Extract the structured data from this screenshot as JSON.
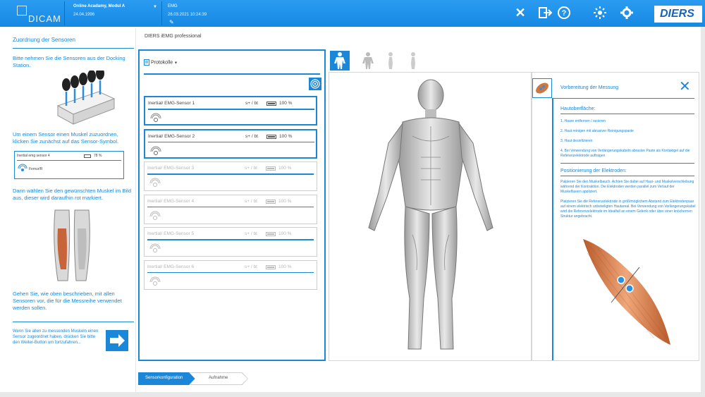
{
  "topbar": {
    "logo_text": "DICAM",
    "patient_name": "Online Acadamy, Modul A",
    "patient_dob": "24.04.1996",
    "exam_type": "EMG",
    "exam_datetime": "26.03.2021 10:24:39",
    "brand": "DIERS",
    "icons": [
      "close-icon",
      "logout-icon",
      "help-icon",
      "sun-icon",
      "gear-icon"
    ]
  },
  "left_panel": {
    "title": "Zuordnung der Sensoren",
    "step1": "Bitte nehmen Sie die Sensoren aus der Docking Station.",
    "step2": "Um einem Sensor einen Muskel zuzuordnen, klicken Sie zunächst auf das Sensor-Symbol.",
    "example_sensor_name": "Inertial emg sensor 4",
    "example_sensor_pct": "78 %",
    "example_sensor_muscle": "Femur/R",
    "step3": "Dann wählen Sie den gewünschten Muskel im Bild aus, dieser wird daraufhin rot markiert.",
    "step4": "Gehen Sie, wie oben beschrieben, mit allen Sensoren vor, die für die Messreihe verwendet werden sollen.",
    "step5": "Wenn Sie allen zu messenden Muskeln einen Sensor zugeordnet haben, drücken Sie bitte den Weiter-Button um fortzufahren..."
  },
  "page_heading": "DIERS iEMG professional",
  "middle_panel": {
    "protocols_label": "Protokolle",
    "sensors": [
      {
        "name": "Inertial/ EMG-Sensor 1",
        "sbt": "s+ / bt",
        "pct": "100 %",
        "active": true
      },
      {
        "name": "Inertial/ EMG-Sensor 2",
        "sbt": "s+ / bt",
        "pct": "100 %",
        "active": true
      },
      {
        "name": "Inertial/ EMG-Sensor 3",
        "sbt": "s+ / bt",
        "pct": "100 %",
        "active": false
      },
      {
        "name": "Inertial/ EMG-Sensor 4",
        "sbt": "s+ / bt",
        "pct": "100 %",
        "active": false
      },
      {
        "name": "Inertial/ EMG-Sensor 5",
        "sbt": "s+ / bt",
        "pct": "100 %",
        "active": false
      },
      {
        "name": "Inertial/ EMG-Sensor 6",
        "sbt": "s+ / bt",
        "pct": "100 %",
        "active": false
      }
    ]
  },
  "info_panel": {
    "title": "Vorbereitung der Messung",
    "skin_heading": "Hautoberfläche:",
    "skin_items": [
      "1. Haare entfernen / rasieren",
      "2. Haut reinigen mit abrasiver Reinigungspaste",
      "3. Haut desinfizieren",
      "4. Bei Verwendung von Verlängerungskabeln abrasive Paste als Kontaktgel auf die Referenzelektrode auftragen"
    ],
    "electrode_heading": "Positionierung der Elektroden:",
    "electrode_text1": "Palpieren Sie den Muskelbauch. Achten Sie dabei auf Haut- und Muskelverschiebung während der Kontraktion. Die Elektroden werden parallel zum Verlauf der Muskelfasern appliziert.",
    "electrode_text2": "Platzieren Sie die Referenzelektrode in größtmöglichem Abstand zum Elektrodenpaar auf einem elektrisch unbeteiligten Hautareal. Bei Verwendung von Verlängerungskabel wird die Referenzelektrode im Idealfall an einem Gelenk oder über einer knöchernen Struktur angebracht."
  },
  "steps": {
    "step1": "Sensorkonfiguration",
    "step2": "Aufnahme"
  }
}
